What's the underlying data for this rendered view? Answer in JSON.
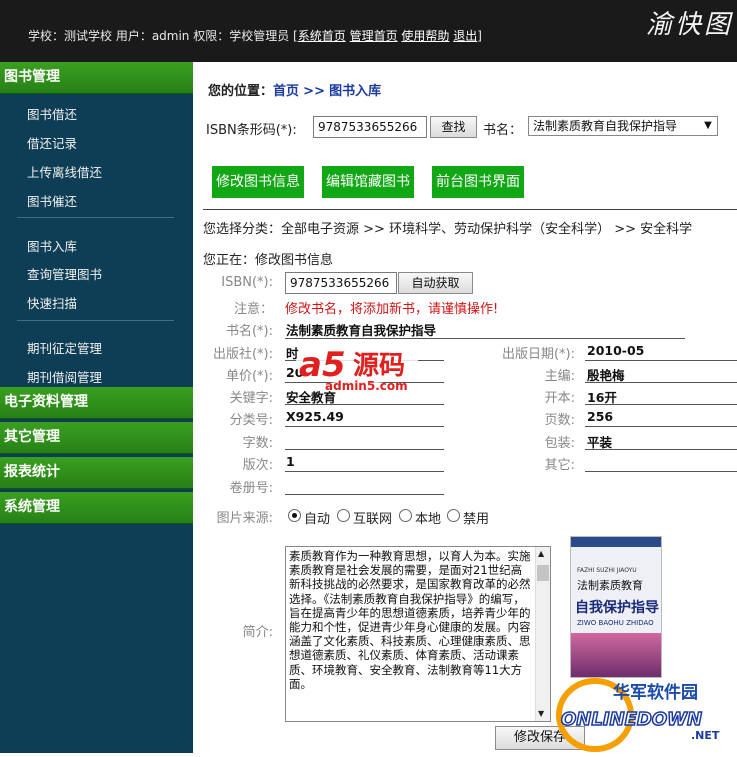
{
  "topbar": {
    "info_prefix": "学校：测试学校 用户：admin 权限：学校管理员 [",
    "links": [
      "系统首页",
      "管理首页",
      "使用帮助",
      "退出"
    ],
    "info_suffix": "]",
    "brand": "渝快图"
  },
  "sidebar": {
    "book_mgmt": "图书管理",
    "items_group1": [
      "图书借还",
      "借还记录",
      "上传离线借还",
      "图书催还"
    ],
    "items_group2": [
      "图书入库",
      "查询管理图书",
      "快速扫描"
    ],
    "items_group3": [
      "期刊征定管理",
      "期刊借阅管理"
    ],
    "sections": [
      "电子资料管理",
      "其它管理",
      "报表统计",
      "系统管理"
    ]
  },
  "breadcrumb": {
    "prefix": "您的位置：",
    "home": "首页",
    "sep": ">>",
    "current": "图书入库"
  },
  "search": {
    "isbn_label": "ISBN条形码(*):",
    "isbn_value": "9787533655266",
    "search_button": "查找",
    "title_label": "书名：",
    "title_selected": "法制素质教育自我保护指导"
  },
  "actions": [
    "修改图书信息",
    "编辑馆藏图书",
    "前台图书界面"
  ],
  "category": {
    "label": "您选择分类：",
    "path": "全部电子资源 >> 环境科学、劳动保护科学（安全科学） >> 安全科学"
  },
  "status": "您正在：修改图书信息",
  "form": {
    "isbn_label": "ISBN(*):",
    "isbn_value": "9787533655266",
    "auto_fetch": "自动获取",
    "note_label": "注意：",
    "note_text": "修改书名，将添加新书，请谨慎操作!",
    "title_label": "书名(*):",
    "title_value": "法制素质教育自我保护指导",
    "publisher_label": "出版社(*):",
    "publisher_value": "时",
    "pubdate_label": "出版日期(*):",
    "pubdate_value": "2010-05",
    "price_label": "单价(*):",
    "price_value": "20",
    "editor_label": "主编:",
    "editor_value": "殷艳梅",
    "keywords_label": "关键字:",
    "keywords_value": "安全教育",
    "format_label": "开本:",
    "format_value": "16开",
    "class_label": "分类号:",
    "class_value": "X925.49",
    "pages_label": "页数:",
    "pages_value": "256",
    "words_label": "字数:",
    "words_value": "",
    "binding_label": "包装:",
    "binding_value": "平装",
    "edition_label": "版次:",
    "edition_value": "1",
    "other_label": "其它:",
    "other_value": "",
    "volume_label": "卷册号:",
    "volume_value": "",
    "img_source_label": "图片来源:",
    "img_options": [
      "自动",
      "互联网",
      "本地",
      "禁用"
    ],
    "img_selected": "自动",
    "desc_label": "简介:",
    "desc_text": "素质教育作为一种教育思想，以育人为本。实施素质教育是社会发展的需要，是面对21世纪高新科技挑战的必然要求，是国家教育改革的必然选择。《法制素质教育自我保护指导》的编写，旨在提高青少年的思想道德素质，培养青少年的能力和个性，促进青少年身心健康的发展。内容涵盖了文化素质、科技素质、心理健康素质、思想道德素质、礼仪素质、体育素质、活动课素质、环境教育、安全教育、法制教育等11大方面。",
    "save_button": "修改保存"
  },
  "cover": {
    "pinyin": "FAZHI SUZHI JIAOYU",
    "line1": "法制素质教育",
    "line2": "自我保护指导",
    "pinyin2": "ZIWO BAOHU ZHIDAO"
  },
  "watermarks": {
    "a5_main": "源码",
    "a5_prefix": "a5",
    "a5_url": "admin5.com",
    "onl_cn": "华军软件园",
    "onl_en": "ONLINEDOWN",
    "onl_tld": ".NET"
  },
  "colors": {
    "sidebar": "#0e3e55",
    "section": "#2a8a18",
    "action_button": "#12a815",
    "link": "#1a3a9e",
    "warning": "#d01515"
  }
}
